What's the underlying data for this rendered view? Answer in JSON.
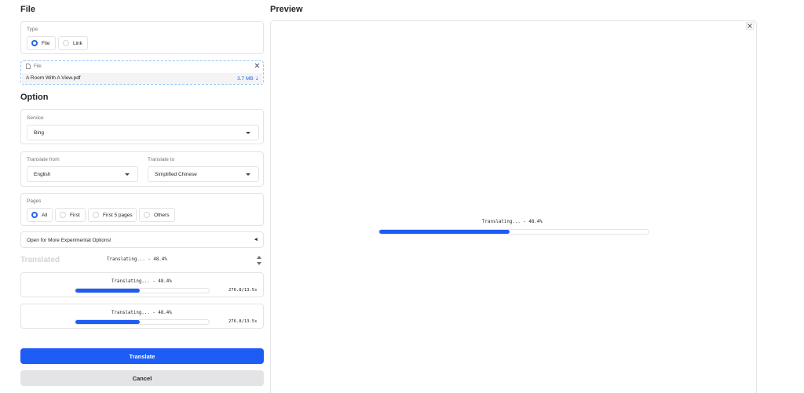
{
  "file_section": {
    "title": "File",
    "type_panel": {
      "label": "Type",
      "options": [
        {
          "label": "File",
          "selected": true
        },
        {
          "label": "Link",
          "selected": false
        }
      ]
    },
    "file_box": {
      "label": "File",
      "file_name": "A Room With A View.pdf",
      "file_size": "3.7 MB ⇣"
    }
  },
  "option_section": {
    "title": "Option",
    "service": {
      "label": "Service",
      "value": "Bing"
    },
    "translate_from": {
      "label": "Translate from",
      "value": "English"
    },
    "translate_to": {
      "label": "Translate to",
      "value": "Simplified Chinese"
    },
    "pages": {
      "label": "Pages",
      "options": [
        {
          "label": "All",
          "selected": true
        },
        {
          "label": "First",
          "selected": false
        },
        {
          "label": "First 5 pages",
          "selected": false
        },
        {
          "label": "Others",
          "selected": false
        }
      ]
    },
    "experimental": {
      "label": "Open for More Experimental Options!",
      "arrow": "◄"
    }
  },
  "translated_section": {
    "title": "Translated",
    "status": "Translating... - 48.4%",
    "outputs": [
      {
        "status": "Translating... - 48.4%",
        "progress": 0.484,
        "timer": "276.8/13.5s"
      },
      {
        "status": "Translating... - 48.4%",
        "progress": 0.484,
        "timer": "276.8/13.5s"
      }
    ]
  },
  "actions": {
    "translate_label": "Translate",
    "cancel_label": "Cancel"
  },
  "preview_section": {
    "title": "Preview",
    "close_glyph": "×",
    "status": "Translating... - 48.4%",
    "progress": 0.484
  },
  "colors": {
    "accent": "#1d5cf5",
    "button_primary": "#1d5cf5",
    "button_secondary": "#e4e4e7"
  }
}
